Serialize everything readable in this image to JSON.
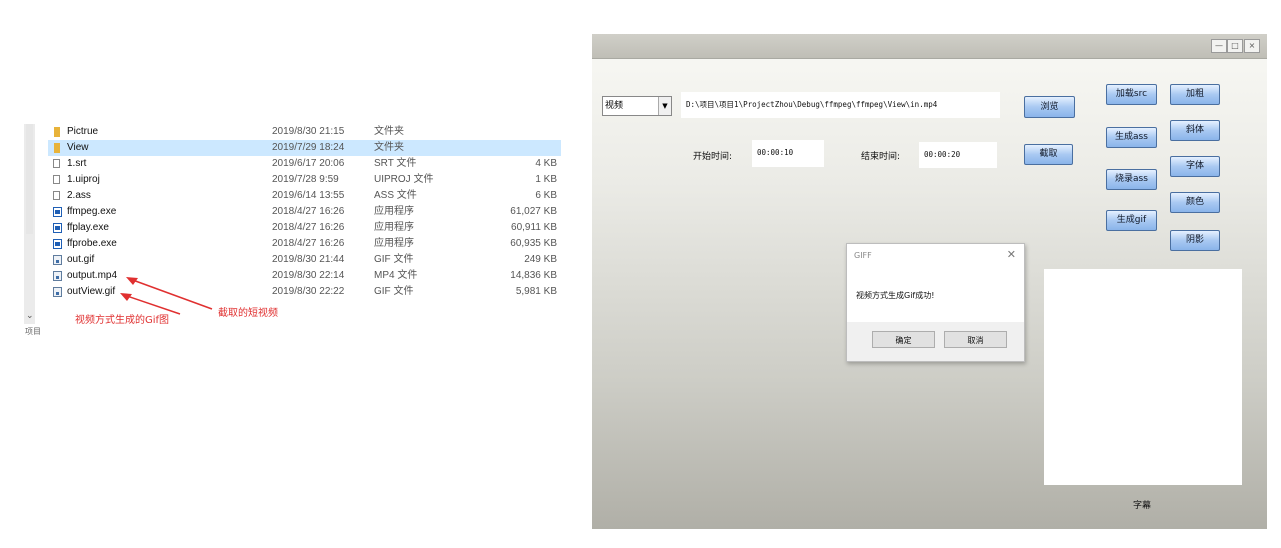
{
  "explorer": {
    "files": [
      {
        "name": "Pictrue",
        "date": "2019/8/30 21:15",
        "type": "文件夹",
        "size": "",
        "icon": "folder-icon",
        "selected": false
      },
      {
        "name": "View",
        "date": "2019/7/29 18:24",
        "type": "文件夹",
        "size": "",
        "icon": "folder-icon",
        "selected": true
      },
      {
        "name": "1.srt",
        "date": "2019/6/17 20:06",
        "type": "SRT 文件",
        "size": "4 KB",
        "icon": "file-icon",
        "selected": false
      },
      {
        "name": "1.uiproj",
        "date": "2019/7/28 9:59",
        "type": "UIPROJ 文件",
        "size": "1 KB",
        "icon": "file-icon",
        "selected": false
      },
      {
        "name": "2.ass",
        "date": "2019/6/14 13:55",
        "type": "ASS 文件",
        "size": "6 KB",
        "icon": "file-icon",
        "selected": false
      },
      {
        "name": "ffmpeg.exe",
        "date": "2018/4/27 16:26",
        "type": "应用程序",
        "size": "61,027 KB",
        "icon": "exe-icon",
        "selected": false
      },
      {
        "name": "ffplay.exe",
        "date": "2018/4/27 16:26",
        "type": "应用程序",
        "size": "60,911 KB",
        "icon": "exe-icon",
        "selected": false
      },
      {
        "name": "ffprobe.exe",
        "date": "2018/4/27 16:26",
        "type": "应用程序",
        "size": "60,935 KB",
        "icon": "exe-icon",
        "selected": false
      },
      {
        "name": "out.gif",
        "date": "2019/8/30 21:44",
        "type": "GIF 文件",
        "size": "249 KB",
        "icon": "media-icon",
        "selected": false
      },
      {
        "name": "output.mp4",
        "date": "2019/8/30 22:14",
        "type": "MP4 文件",
        "size": "14,836 KB",
        "icon": "media-icon",
        "selected": false
      },
      {
        "name": "outView.gif",
        "date": "2019/8/30 22:22",
        "type": "GIF 文件",
        "size": "5,981 KB",
        "icon": "media-icon",
        "selected": false
      }
    ],
    "scroll_label": "项目"
  },
  "annotations": {
    "clip_label": "截取的短视频",
    "gif_label": "视频方式生成的Gif图",
    "color": "#e03030"
  },
  "app": {
    "media_type": "视频",
    "path": "D:\\项目\\项目1\\ProjectZhou\\Debug\\ffmpeg\\ffmpeg\\View\\in.mp4",
    "browse": "浏览",
    "start_label": "开始时间:",
    "start_value": "00:00:10",
    "end_label": "结束时间:",
    "end_value": "00:00:20",
    "clip": "截取",
    "left_buttons": [
      "加载src",
      "生成ass",
      "烧录ass",
      "生成gif"
    ],
    "right_buttons": [
      "加粗",
      "斜体",
      "字体",
      "颜色",
      "阴影"
    ],
    "subtitle_label": "字幕",
    "window_buttons": [
      "—",
      "□",
      "×"
    ]
  },
  "dialog": {
    "title": "GIFF",
    "message": "视频方式生成Gif成功!",
    "ok": "确定",
    "cancel": "取消"
  }
}
